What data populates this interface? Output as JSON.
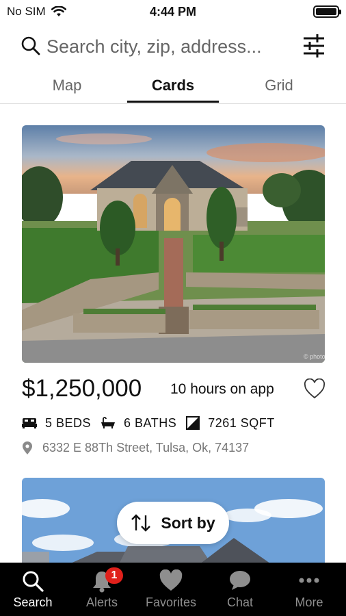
{
  "status_bar": {
    "carrier": "No SIM",
    "time": "4:44 PM",
    "battery_level": 1.0
  },
  "search": {
    "placeholder": "Search city, zip, address..."
  },
  "tabs": [
    {
      "label": "Map",
      "active": false
    },
    {
      "label": "Cards",
      "active": true
    },
    {
      "label": "Grid",
      "active": false
    }
  ],
  "listings": [
    {
      "price": "$1,250,000",
      "time_on_app": "10 hours on app",
      "beds": "5 BEDS",
      "baths": "6 BATHS",
      "sqft": "7261 SQFT",
      "address": "6332 E 88Th Street, Tulsa, Ok, 74137"
    }
  ],
  "sort_button": {
    "label": "Sort by"
  },
  "bottom_nav": [
    {
      "label": "Search",
      "icon": "search-icon",
      "active": true
    },
    {
      "label": "Alerts",
      "icon": "bell-icon",
      "badge": "1"
    },
    {
      "label": "Favorites",
      "icon": "heart-icon"
    },
    {
      "label": "Chat",
      "icon": "chat-bubble-icon"
    },
    {
      "label": "More",
      "icon": "more-dots-icon"
    }
  ],
  "colors": {
    "nav_background": "#000000",
    "badge": "#e0201b",
    "active_tab": "#111111"
  }
}
